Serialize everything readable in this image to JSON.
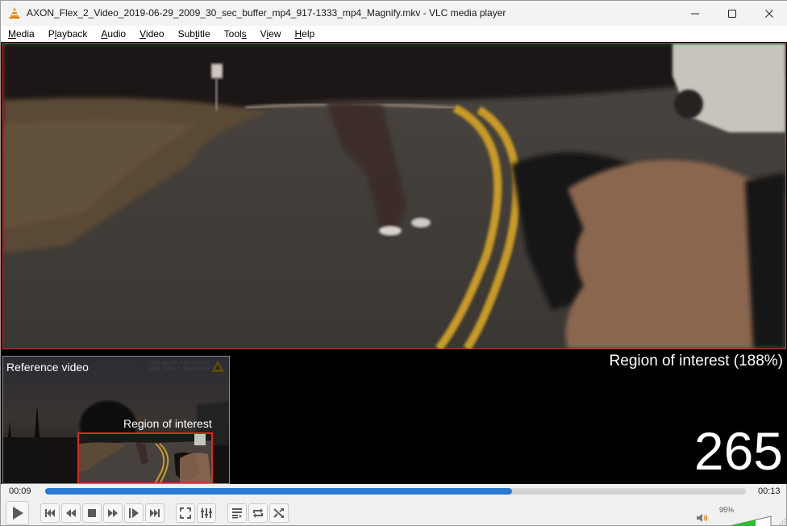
{
  "window": {
    "title": "AXON_Flex_2_Video_2019-06-29_2009_30_sec_buffer_mp4_917-1333_mp4_Magnify.mkv - VLC media player",
    "app_icon": "vlc-cone-icon",
    "controls": [
      "minimize-icon",
      "maximize-icon",
      "close-icon"
    ]
  },
  "menubar": {
    "items": [
      {
        "label": "Media",
        "accel": "M"
      },
      {
        "label": "Playback",
        "accel": "l"
      },
      {
        "label": "Audio",
        "accel": "A"
      },
      {
        "label": "Video",
        "accel": "V"
      },
      {
        "label": "Subtitle",
        "accel": "t"
      },
      {
        "label": "Tools",
        "accel": "s"
      },
      {
        "label": "View",
        "accel": "i"
      },
      {
        "label": "Help",
        "accel": "H"
      }
    ]
  },
  "video": {
    "roi_label": "Region of interest (188%)",
    "frame_number": "265",
    "reference": {
      "label": "Reference video",
      "stamp_line1": "2019-06-30 T03:09:25Z",
      "stamp_line2": "AXON FLEX 2 X83078783",
      "roi_label": "Region of interest"
    },
    "colors": {
      "roi_border": "#e0281e",
      "road_line": "#c89a28"
    }
  },
  "seek": {
    "elapsed": "00:09",
    "total": "00:13",
    "progress_fraction": 0.666,
    "fill_color": "#2a78d0"
  },
  "controls": {
    "buttons": [
      {
        "name": "play-button",
        "icon": "play-icon"
      },
      {
        "name": "previous-button",
        "icon": "skip-previous-icon"
      },
      {
        "name": "slower-button",
        "icon": "rewind-icon"
      },
      {
        "name": "stop-button",
        "icon": "stop-icon"
      },
      {
        "name": "faster-button",
        "icon": "fast-forward-icon"
      },
      {
        "name": "frame-step-button",
        "icon": "frame-step-icon"
      },
      {
        "name": "next-button",
        "icon": "skip-next-icon"
      },
      {
        "name": "fullscreen-button",
        "icon": "fullscreen-icon"
      },
      {
        "name": "extended-settings-button",
        "icon": "equalizer-icon"
      },
      {
        "name": "playlist-button",
        "icon": "playlist-icon"
      },
      {
        "name": "loop-button",
        "icon": "loop-icon"
      },
      {
        "name": "shuffle-button",
        "icon": "shuffle-icon"
      }
    ],
    "volume": {
      "label": "95%",
      "level_fraction": 0.95,
      "icon": "speaker-icon",
      "fill_color": "#22c42a"
    }
  }
}
